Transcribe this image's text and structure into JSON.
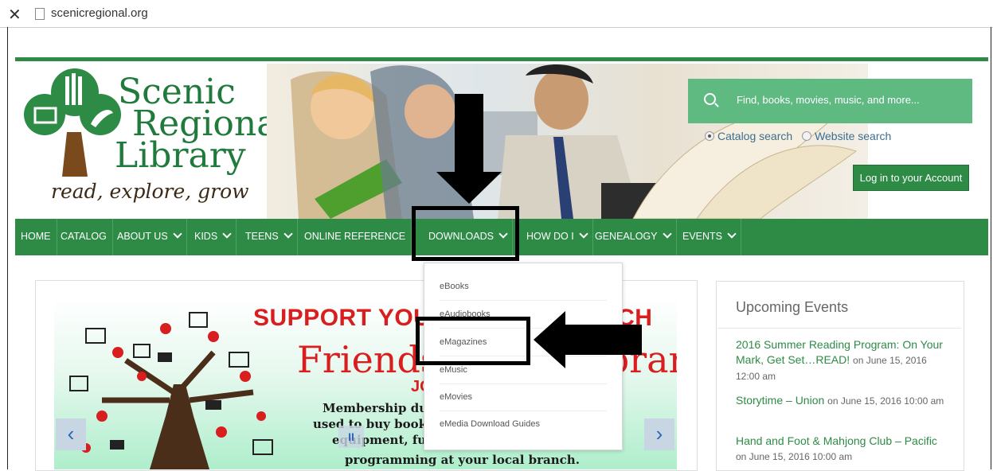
{
  "browser": {
    "close_glyph": "✕",
    "url": "scenicregional.org"
  },
  "site": {
    "logo_lines": [
      "Scenic",
      "Regional",
      "Library"
    ],
    "tagline": "read, explore, grow"
  },
  "search": {
    "placeholder": "Find, books, movies, music, and more...",
    "option_catalog": "Catalog search",
    "option_website": "Website search",
    "selected": "catalog"
  },
  "login_button": "Log in to your Account",
  "nav": {
    "items": [
      {
        "label": "HOME",
        "dropdown": false
      },
      {
        "label": "CATALOG",
        "dropdown": false
      },
      {
        "label": "ABOUT US",
        "dropdown": true
      },
      {
        "label": "KIDS",
        "dropdown": true
      },
      {
        "label": "TEENS",
        "dropdown": true
      },
      {
        "label": "ONLINE REFERENCE",
        "dropdown": false
      },
      {
        "label": "DOWNLOADS",
        "dropdown": true
      },
      {
        "label": "HOW DO I",
        "dropdown": true
      },
      {
        "label": "GENEALOGY",
        "dropdown": true
      },
      {
        "label": "EVENTS",
        "dropdown": true
      }
    ]
  },
  "downloads_menu": {
    "items": [
      "eBooks",
      "eAudiobooks",
      "eMagazines",
      "eMusic",
      "eMovies",
      "eMedia Download Guides"
    ]
  },
  "slider": {
    "headline": "SUPPORT YOUR LOCAL BRANCH",
    "title": "Friends of the Library",
    "subtitle": "JOIN",
    "body_lines": [
      "Membership dues are",
      "used to buy books and",
      "equipment, fund",
      "programming at your local branch."
    ],
    "prev": "‹",
    "next": "›",
    "pause": "II"
  },
  "events": {
    "title": "Upcoming Events",
    "items": [
      {
        "title": "2016 Summer Reading Program: On Your Mark, Get Set…READ!",
        "date": "on June 15, 2016 12:00 am"
      },
      {
        "title": "Storytime – Union",
        "date": "on June 15, 2016 10:00 am"
      },
      {
        "title": "Hand and Foot & Mahjong Club – Pacific",
        "date": "on June 15, 2016 10:00 am"
      }
    ]
  },
  "colors": {
    "brand_green": "#2e8b46",
    "search_green": "#5fba82",
    "link_blue": "#3c6e8f",
    "headline_red": "#d81e1e"
  }
}
